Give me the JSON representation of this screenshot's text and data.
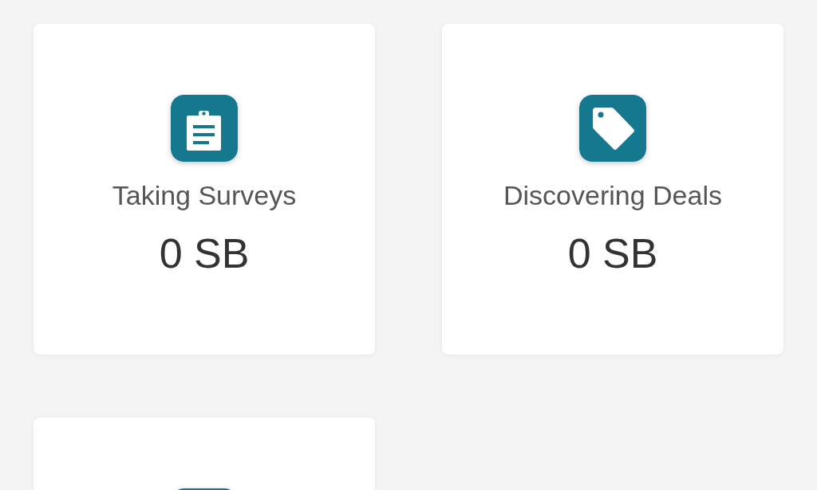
{
  "cards": [
    {
      "kind": "earnings",
      "title": "Taking Surveys",
      "amount": "0 SB"
    },
    {
      "kind": "earnings",
      "title": "Discovering Deals",
      "amount": "0 SB"
    },
    {
      "kind": "earnings"
    }
  ]
}
